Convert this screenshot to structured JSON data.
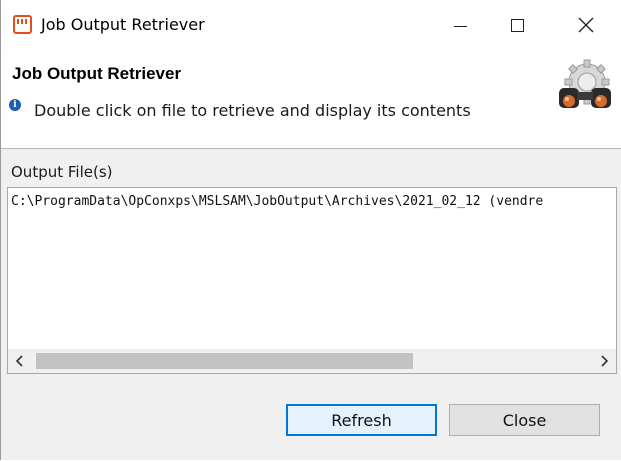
{
  "window": {
    "title": "Job Output Retriever",
    "accent_color": "#0078d7",
    "icon": "app-window-icon"
  },
  "header": {
    "title": "Job Output Retriever",
    "info_text": "Double click on file to retrieve and display its contents",
    "info_icon": "info-icon",
    "banner_icon": "gear-binoculars-icon"
  },
  "output": {
    "label": "Output File(s)",
    "files": [
      "C:\\ProgramData\\OpConxps\\MSLSAM\\JobOutput\\Archives\\2021_02_12 (vendre"
    ]
  },
  "buttons": {
    "refresh": "Refresh",
    "close": "Close"
  }
}
